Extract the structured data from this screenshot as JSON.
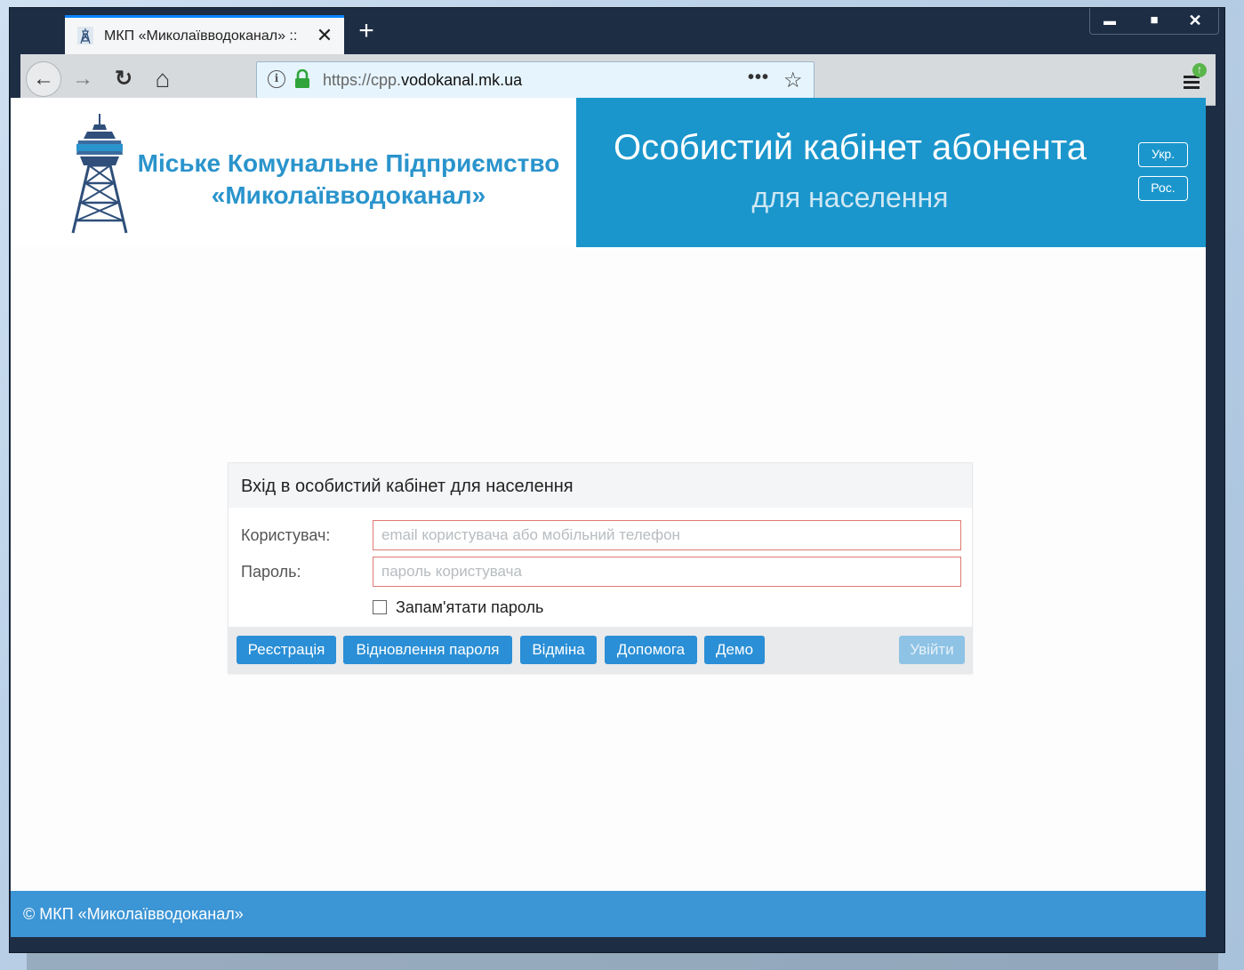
{
  "browser": {
    "tab_title": "МКП «Миколаївводоканал» ::",
    "tab_close_glyph": "✕",
    "new_tab_glyph": "+",
    "url_scheme": "https://cpp.",
    "url_host": "vodokanal.mk.ua",
    "url_more_glyph": "•••",
    "star_glyph": "☆",
    "back_glyph": "←",
    "forward_glyph": "→",
    "reload_glyph": "↻",
    "home_glyph": "⌂",
    "info_glyph": "i",
    "minimize_glyph": "▬",
    "maximize_glyph": "■",
    "close_glyph": "✕",
    "update_badge_glyph": "↑"
  },
  "header": {
    "org_line1": "Міське Комунальне Підприємство",
    "org_line2": "«Миколаївводоканал»",
    "portal_title": "Особистий кабінет абонента",
    "portal_subtitle": "для населення",
    "lang_ukr": "Укр.",
    "lang_rus": "Рос."
  },
  "login": {
    "title": "Вхід в особистий кабінет для населення",
    "user_label": "Користувач:",
    "user_placeholder": "email користувача або мобільний телефон",
    "password_label": "Пароль:",
    "password_placeholder": "пароль користувача",
    "remember_label": "Запам'ятати пароль",
    "buttons": {
      "register": "Реєстрація",
      "recover": "Відновлення пароля",
      "cancel": "Відміна",
      "help": "Допомога",
      "demo": "Демо",
      "login": "Увійти"
    }
  },
  "footer": {
    "copyright": "© МКП «Миколаївводоканал»"
  },
  "colors": {
    "brand_blue": "#1a96cc",
    "button_blue": "#2a8fd6",
    "footer_blue": "#3c95d5",
    "input_error_border": "#e07a72"
  },
  "icons": {
    "logo": "water-tower-logo",
    "favicon": "water-tower-favicon",
    "lock": "lock-icon",
    "menu": "hamburger-icon"
  }
}
